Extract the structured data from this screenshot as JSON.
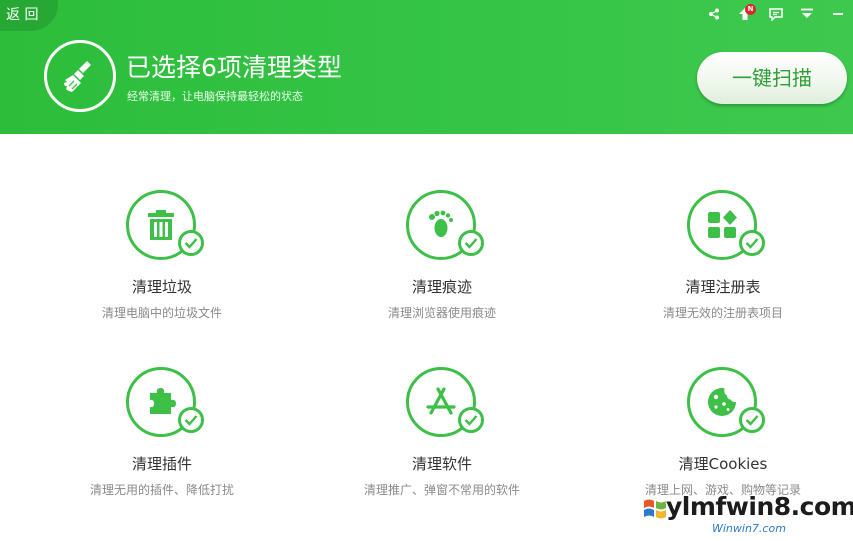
{
  "header": {
    "back_label": "返 回",
    "title": "已选择6项清理类型",
    "subtitle": "经常清理，让电脑保持最轻松的状态",
    "scan_button": "一键扫描",
    "badge": "N"
  },
  "cards": [
    {
      "title": "清理垃圾",
      "desc": "清理电脑中的垃圾文件",
      "icon": "trash-icon"
    },
    {
      "title": "清理痕迹",
      "desc": "清理浏览器使用痕迹",
      "icon": "footprint-icon"
    },
    {
      "title": "清理注册表",
      "desc": "清理无效的注册表项目",
      "icon": "registry-icon"
    },
    {
      "title": "清理插件",
      "desc": "清理无用的插件、降低打扰",
      "icon": "puzzle-icon"
    },
    {
      "title": "清理软件",
      "desc": "清理推广、弹窗不常用的软件",
      "icon": "app-store-icon"
    },
    {
      "title": "清理Cookies",
      "desc": "清理上网、游戏、购物等记录",
      "icon": "cookie-icon"
    }
  ],
  "watermark": {
    "text": "ylmfwin8.com",
    "sub": "Winwin7.com"
  },
  "colors": {
    "accent": "#3dbf48",
    "header_bg": "#35c446",
    "text": "#333333",
    "muted": "#8a8a8a"
  }
}
